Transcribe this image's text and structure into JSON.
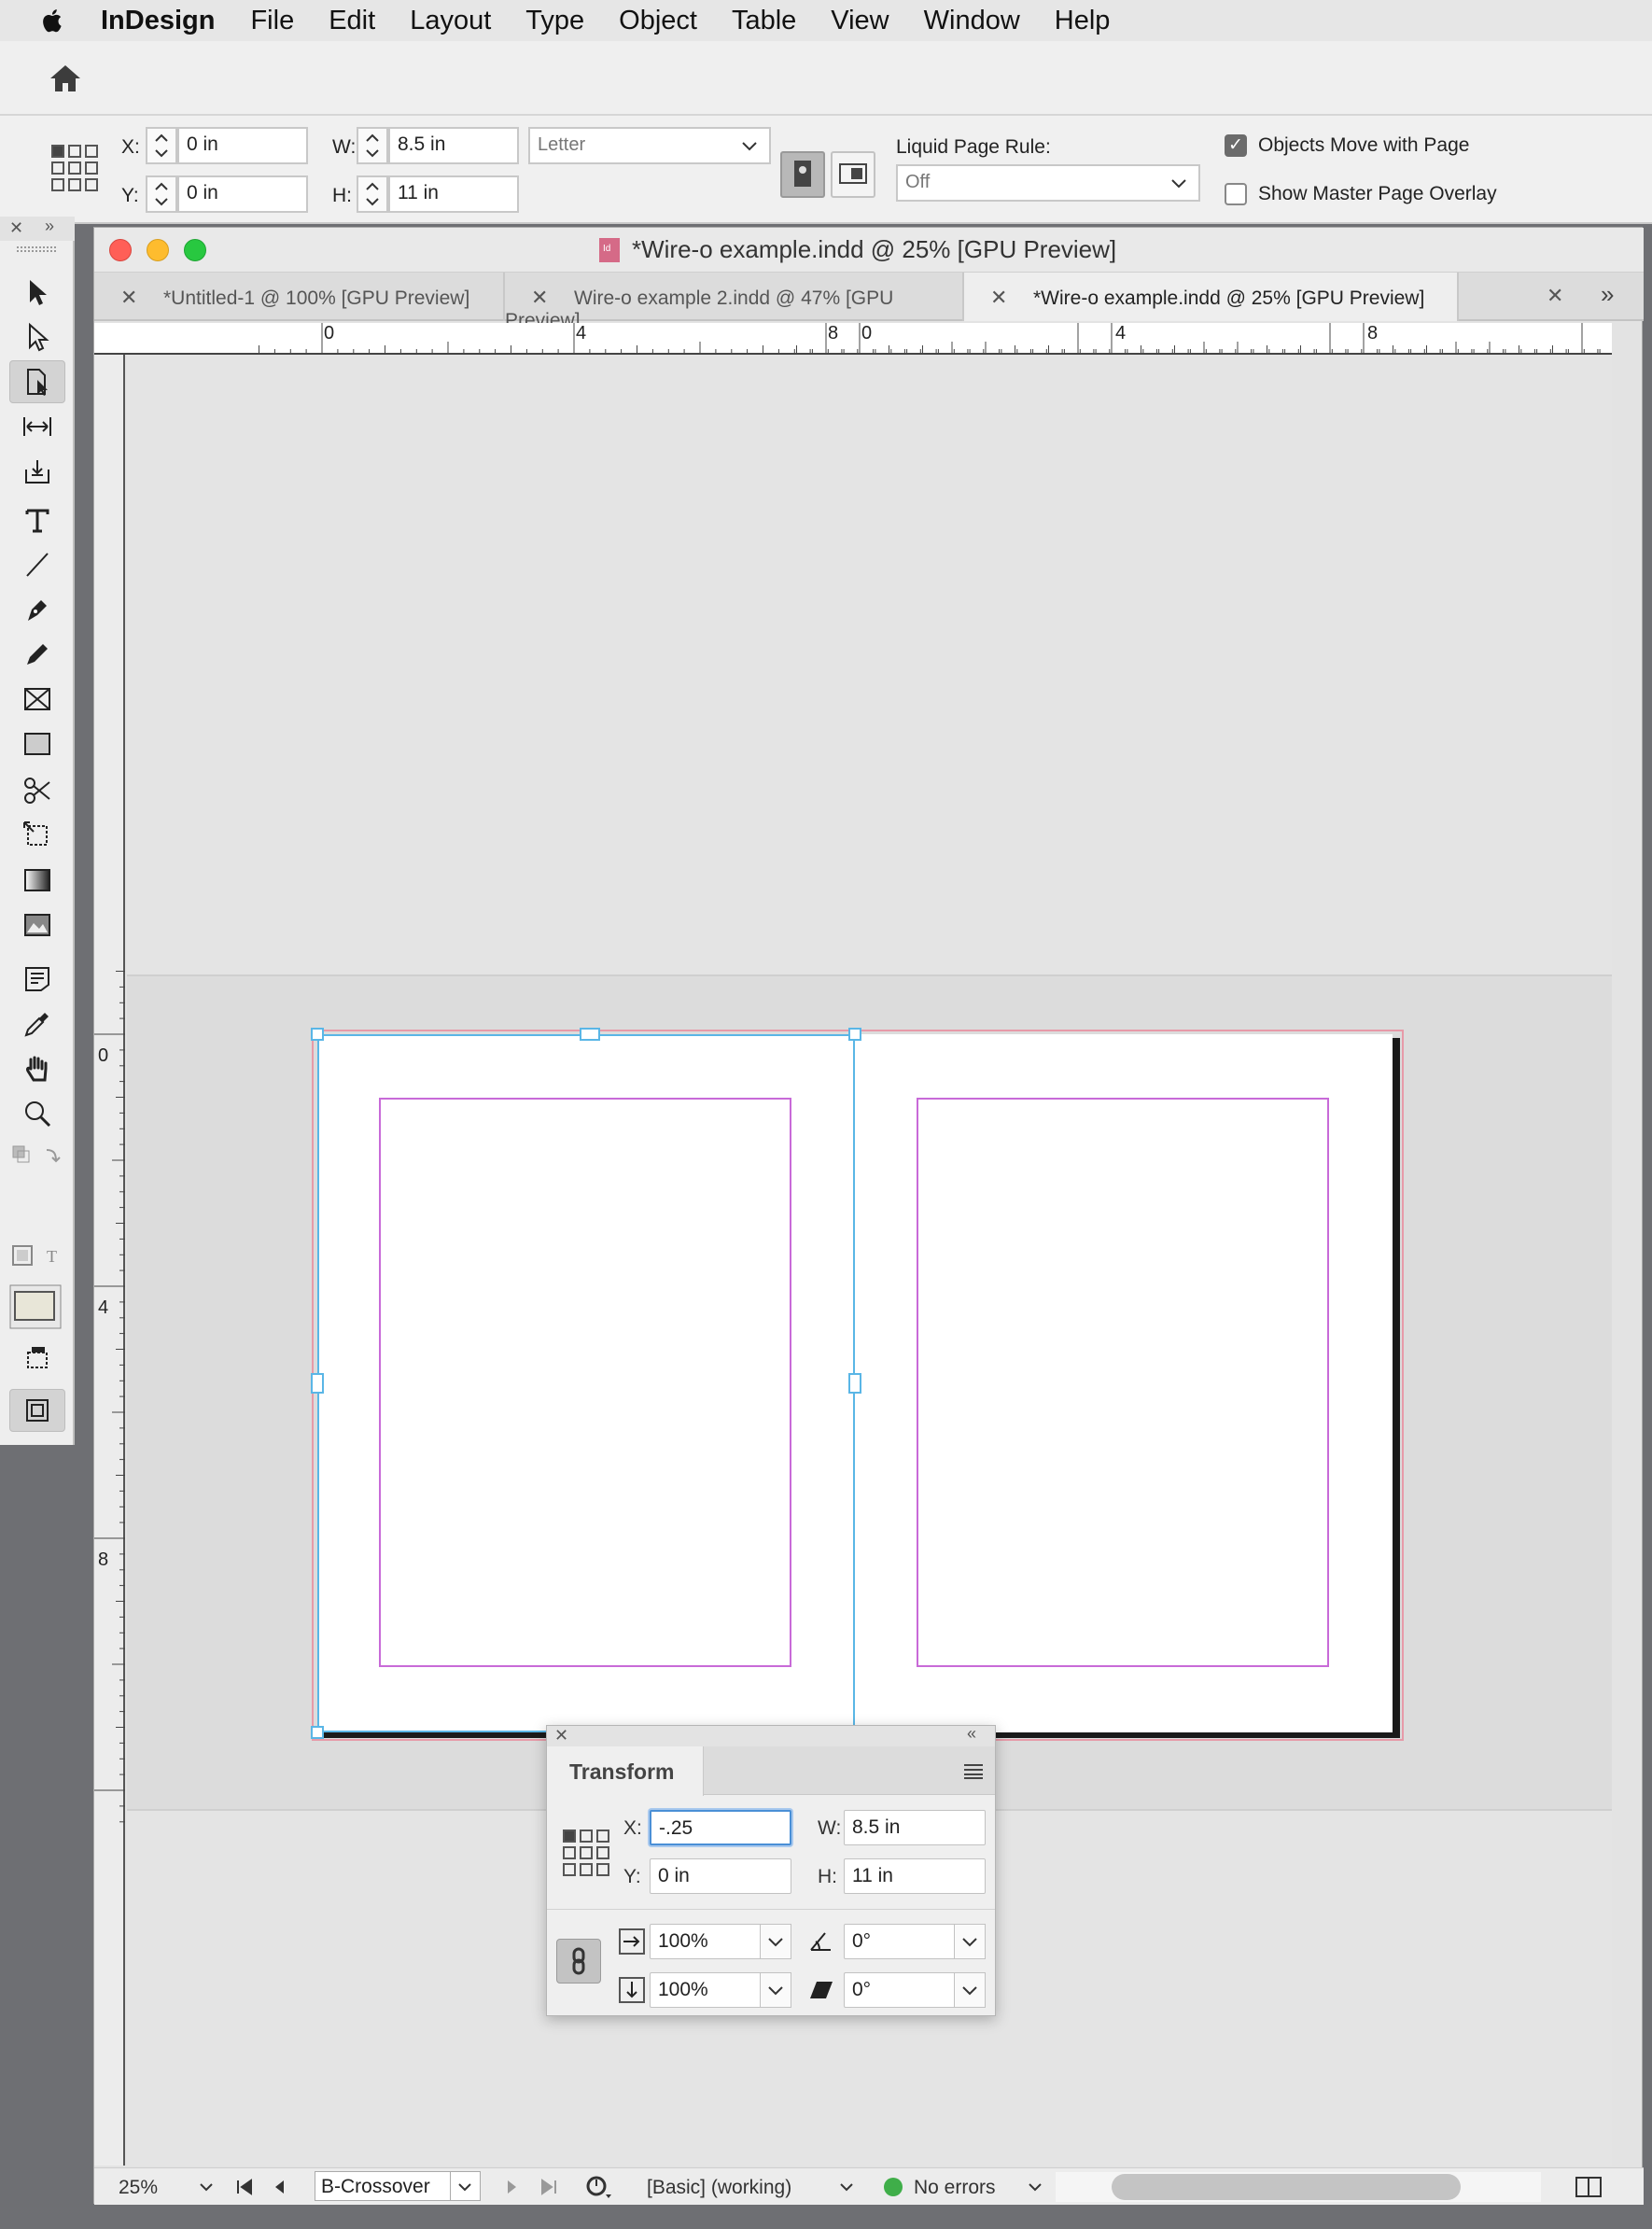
{
  "menubar": {
    "app_name": "InDesign",
    "items": [
      "File",
      "Edit",
      "Layout",
      "Type",
      "Object",
      "Table",
      "View",
      "Window",
      "Help"
    ]
  },
  "control": {
    "x_label": "X:",
    "x_value": "0 in",
    "y_label": "Y:",
    "y_value": "0 in",
    "w_label": "W:",
    "w_value": "8.5 in",
    "h_label": "H:",
    "h_value": "11 in",
    "page_size": "Letter",
    "liquid_label": "Liquid Page Rule:",
    "liquid_value": "Off",
    "objects_move_label": "Objects Move with Page",
    "objects_move_checked": true,
    "show_master_label": "Show Master Page Overlay",
    "show_master_checked": false
  },
  "document": {
    "window_title": "*Wire-o example.indd @ 25% [GPU Preview]",
    "tabs": [
      {
        "label": "*Untitled-1 @ 100% [GPU Preview]",
        "active": false
      },
      {
        "label": "Wire-o example 2.indd @ 47% [GPU Preview]",
        "active": false
      },
      {
        "label": "*Wire-o example.indd @ 25% [GPU Preview]",
        "active": true
      }
    ],
    "h_ruler_labels": [
      "0",
      "4",
      "8",
      "0",
      "4",
      "8"
    ],
    "v_ruler_labels": [
      "0",
      "4",
      "8"
    ]
  },
  "status": {
    "zoom": "25%",
    "page": "B-Crossover",
    "style": "[Basic] (working)",
    "errors": "No errors",
    "error_color": "#3fae49"
  },
  "transform": {
    "title": "Transform",
    "x_label": "X:",
    "x_value": "-.25",
    "y_label": "Y:",
    "y_value": "0 in",
    "w_label": "W:",
    "w_value": "8.5 in",
    "h_label": "H:",
    "h_value": "11 in",
    "scale_x": "100%",
    "scale_y": "100%",
    "rotate": "0°",
    "shear": "0°"
  }
}
